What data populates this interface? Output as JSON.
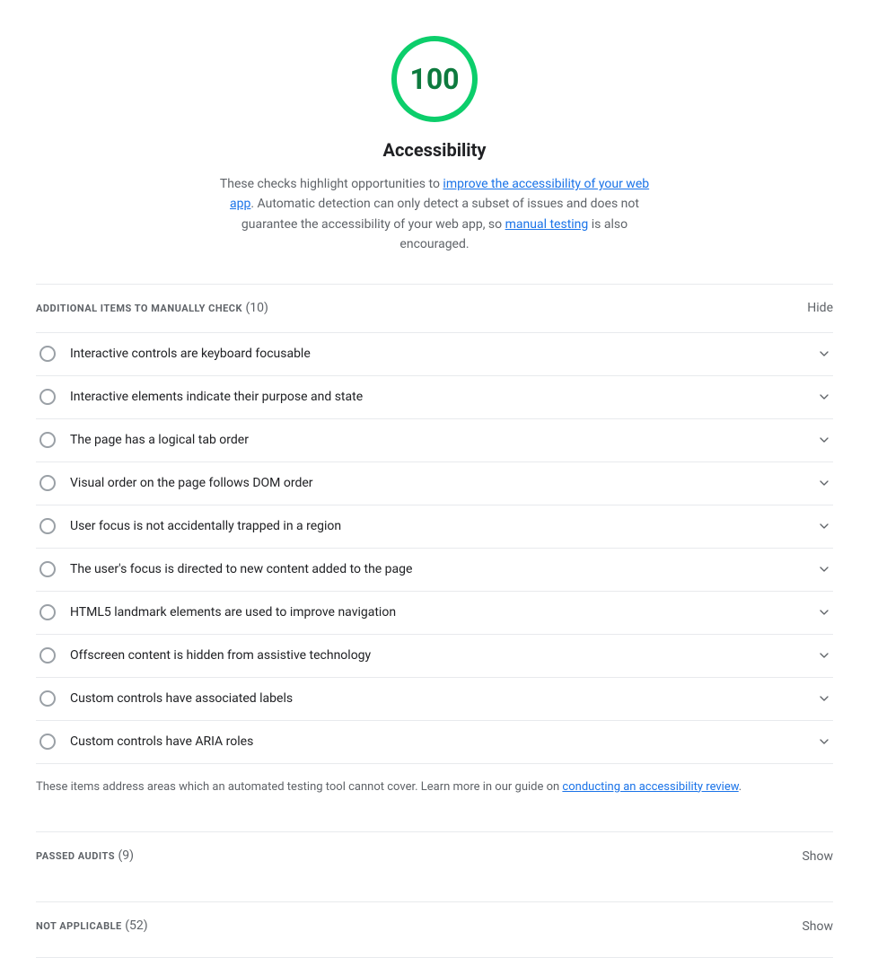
{
  "score": {
    "value": "100",
    "color": "#0cce6b",
    "number_color": "#0d7a3e"
  },
  "title": "Accessibility",
  "description": {
    "prefix": "These checks highlight opportunities to ",
    "link1_text": "improve the accessibility of your web app",
    "link1_href": "#",
    "middle": ". Automatic detection can only detect a subset of issues and does not guarantee the accessibility of your web app, so ",
    "link2_text": "manual testing",
    "link2_href": "#",
    "suffix": " is also encouraged."
  },
  "additional_section": {
    "label": "ADDITIONAL ITEMS TO MANUALLY CHECK",
    "count": "(10)",
    "hide_label": "Hide",
    "items": [
      {
        "text": "Interactive controls are keyboard focusable"
      },
      {
        "text": "Interactive elements indicate their purpose and state"
      },
      {
        "text": "The page has a logical tab order"
      },
      {
        "text": "Visual order on the page follows DOM order"
      },
      {
        "text": "User focus is not accidentally trapped in a region"
      },
      {
        "text": "The user's focus is directed to new content added to the page"
      },
      {
        "text": "HTML5 landmark elements are used to improve navigation"
      },
      {
        "text": "Offscreen content is hidden from assistive technology"
      },
      {
        "text": "Custom controls have associated labels"
      },
      {
        "text": "Custom controls have ARIA roles"
      }
    ],
    "footer_prefix": "These items address areas which an automated testing tool cannot cover. Learn more in our guide on ",
    "footer_link_text": "conducting an accessibility review",
    "footer_link_href": "#",
    "footer_suffix": "."
  },
  "passed_section": {
    "label": "PASSED AUDITS",
    "count": "(9)",
    "show_label": "Show"
  },
  "not_applicable_section": {
    "label": "NOT APPLICABLE",
    "count": "(52)",
    "show_label": "Show"
  }
}
